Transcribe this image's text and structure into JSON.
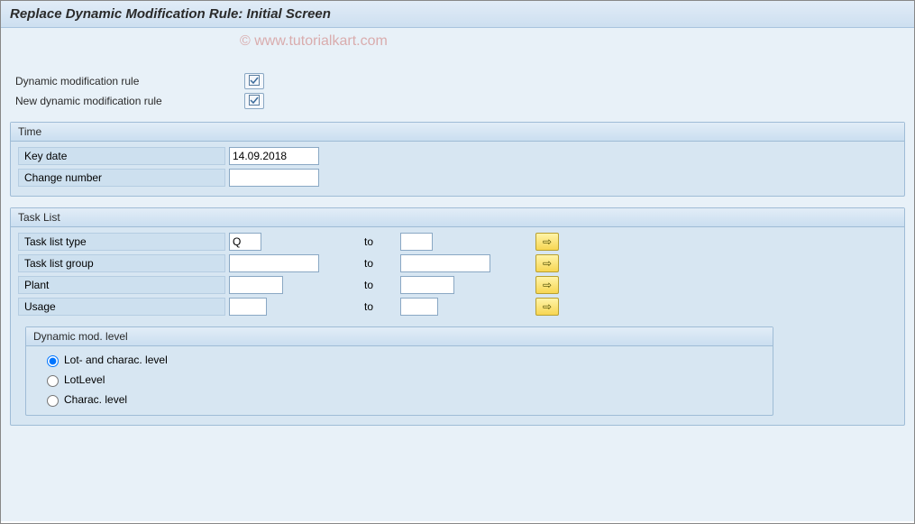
{
  "title": "Replace Dynamic Modification Rule: Initial Screen",
  "watermark": "© www.tutorialkart.com",
  "top": {
    "dyn_mod_rule_label": "Dynamic modification rule",
    "new_dyn_mod_rule_label": "New dynamic modification rule"
  },
  "group_time": {
    "title": "Time",
    "key_date_label": "Key date",
    "key_date_value": "14.09.2018",
    "change_number_label": "Change number",
    "change_number_value": ""
  },
  "group_tasklist": {
    "title": "Task List",
    "to_label": "to",
    "rows": {
      "type": {
        "label": "Task list type",
        "from": "Q",
        "to": ""
      },
      "group": {
        "label": "Task list group",
        "from": "",
        "to": ""
      },
      "plant": {
        "label": "Plant",
        "from": "",
        "to": ""
      },
      "usage": {
        "label": "Usage",
        "from": "",
        "to": ""
      }
    },
    "dyn_level": {
      "title": "Dynamic mod. level",
      "opt1": "Lot- and charac. level",
      "opt2": "LotLevel",
      "opt3": "Charac. level",
      "selected": "opt1"
    }
  },
  "icons": {
    "valuehelp": "☑",
    "arrow": "⇨"
  }
}
